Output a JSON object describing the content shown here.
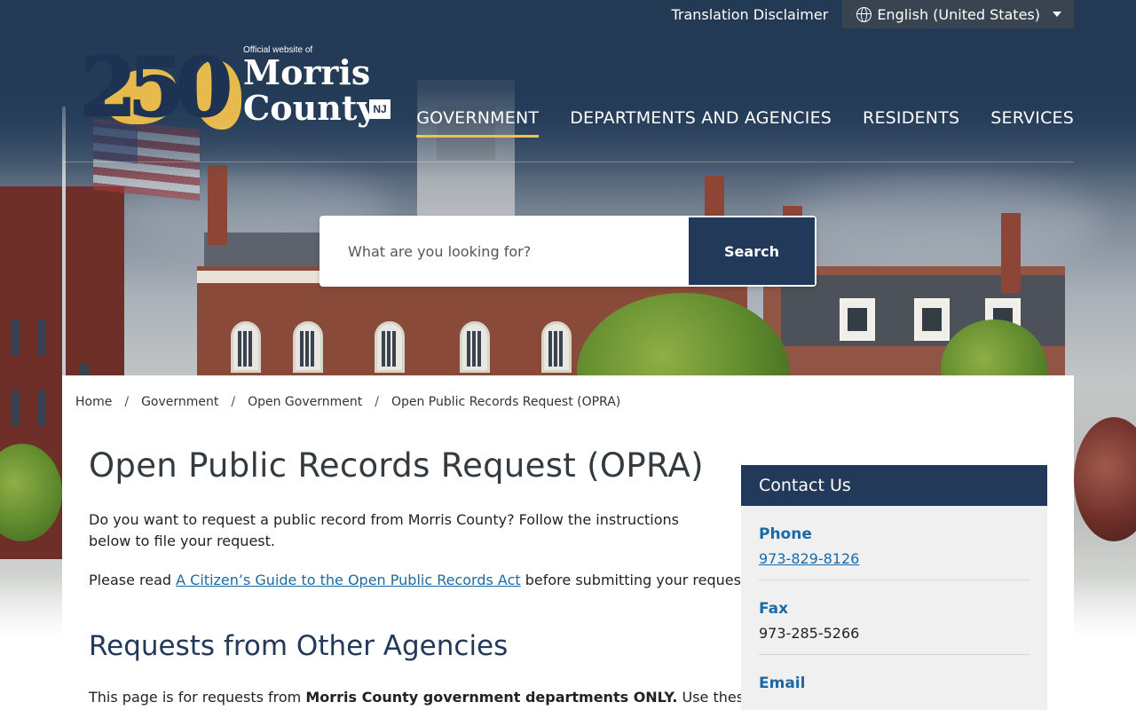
{
  "topbar": {
    "disclaimer": "Translation Disclaimer",
    "language": "English (United States)"
  },
  "logo": {
    "number": "250",
    "official": "Official website of",
    "name_line1": "Morris",
    "name_line2": "County",
    "state": "NJ"
  },
  "nav": {
    "items": [
      {
        "label": "GOVERNMENT",
        "active": true
      },
      {
        "label": "DEPARTMENTS AND AGENCIES",
        "active": false
      },
      {
        "label": "RESIDENTS",
        "active": false
      },
      {
        "label": "SERVICES",
        "active": false
      }
    ]
  },
  "search": {
    "placeholder": "What are you looking for?",
    "button": "Search"
  },
  "breadcrumb": {
    "items": [
      "Home",
      "Government",
      "Open Government",
      "Open Public Records Request (OPRA)"
    ],
    "separator": "/"
  },
  "main": {
    "title": "Open Public Records Request (OPRA)",
    "intro": "Do you want to request a public record from Morris County? Follow the instructions below to file your request.",
    "read_prefix": "Please read",
    "read_link": "A Citizen’s Guide to the Open Public Records Act",
    "read_suffix": "before submitting your request.",
    "section_heading": "Requests from Other Agencies",
    "agencies_prefix": "This page is for requests from",
    "agencies_bold": "Morris County government departments ONLY.",
    "agencies_suffix": "Use these links"
  },
  "contact": {
    "heading": "Contact Us",
    "phone_label": "Phone",
    "phone_value": "973-829-8126",
    "fax_label": "Fax",
    "fax_value": "973-285-5266",
    "email_label": "Email"
  },
  "colors": {
    "navy": "#23395a",
    "accent_gold": "#f2c14e",
    "link_blue": "#1b6aa6"
  }
}
